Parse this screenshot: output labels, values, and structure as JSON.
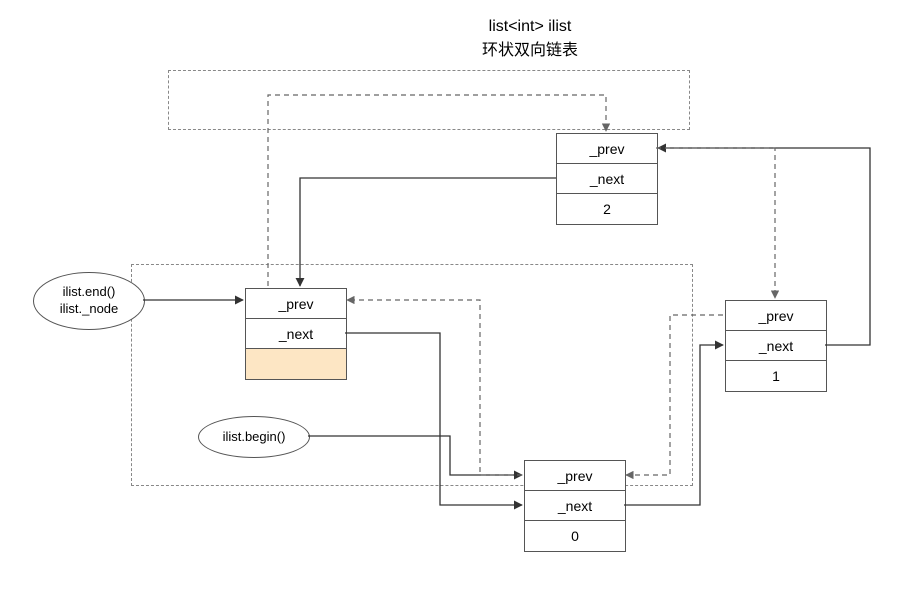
{
  "title": {
    "line1": "list<int> ilist",
    "line2": "环状双向链表"
  },
  "labels": {
    "end_node_l1": "ilist.end()",
    "end_node_l2": "ilist._node",
    "begin": "ilist.begin()"
  },
  "node_fields": {
    "prev": "_prev",
    "next": "_next"
  },
  "nodes": {
    "sentinel": {
      "data": ""
    },
    "n2": {
      "data": "2"
    },
    "n1": {
      "data": "1"
    },
    "n0": {
      "data": "0"
    }
  },
  "chart_data": {
    "type": "diagram",
    "structure": "circular doubly-linked list",
    "container": "list<int> ilist",
    "sentinel": {
      "role": "end/_node",
      "prev": "n2",
      "next": "n0",
      "data": null
    },
    "elements": [
      {
        "id": "n0",
        "value": 0,
        "prev": "sentinel",
        "next": "n1"
      },
      {
        "id": "n1",
        "value": 1,
        "prev": "n0",
        "next": "n2"
      },
      {
        "id": "n2",
        "value": 2,
        "prev": "n1",
        "next": "sentinel"
      }
    ],
    "iterators": {
      "begin": "n0",
      "end": "sentinel"
    }
  }
}
